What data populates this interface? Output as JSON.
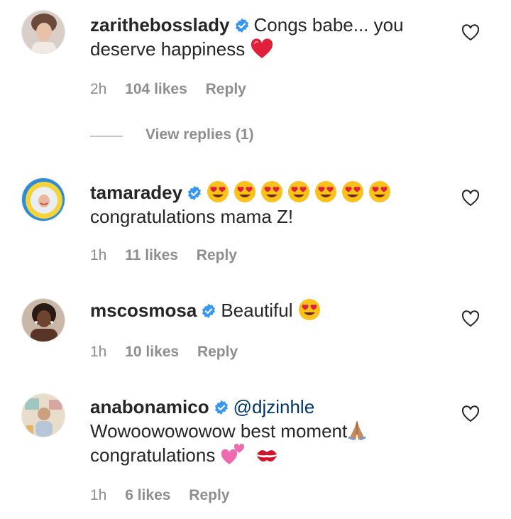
{
  "comments": [
    {
      "username": "zarithebosslady",
      "text": "Congs babe... you deserve happiness",
      "emoji_suffix": "red-heart",
      "time": "2h",
      "likes": "104 likes",
      "reply": "Reply",
      "view_replies": "View replies (1)"
    },
    {
      "username": "tamaradey",
      "emoji_line": [
        "heart-eyes",
        "heart-eyes",
        "heart-eyes",
        "heart-eyes",
        "heart-eyes",
        "heart-eyes",
        "heart-eyes"
      ],
      "text": "congratulations mama Z!",
      "time": "1h",
      "likes": "11 likes",
      "reply": "Reply"
    },
    {
      "username": "mscosmosa",
      "text": "Beautiful",
      "emoji_suffix": "heart-eyes",
      "time": "1h",
      "likes": "10 likes",
      "reply": "Reply"
    },
    {
      "username": "anabonamico",
      "mention": "@djzinhle",
      "text_line2": "Wowoowowowow best moment",
      "text_line3": "congratulations",
      "emoji_suffix": [
        "folded-hands",
        "two-hearts",
        "kiss-mark"
      ],
      "time": "1h",
      "likes": "6 likes",
      "reply": "Reply"
    }
  ],
  "colors": {
    "verified": "#3897f0",
    "muted": "#8e8e8e",
    "mention": "#00376b",
    "text": "#262626"
  }
}
